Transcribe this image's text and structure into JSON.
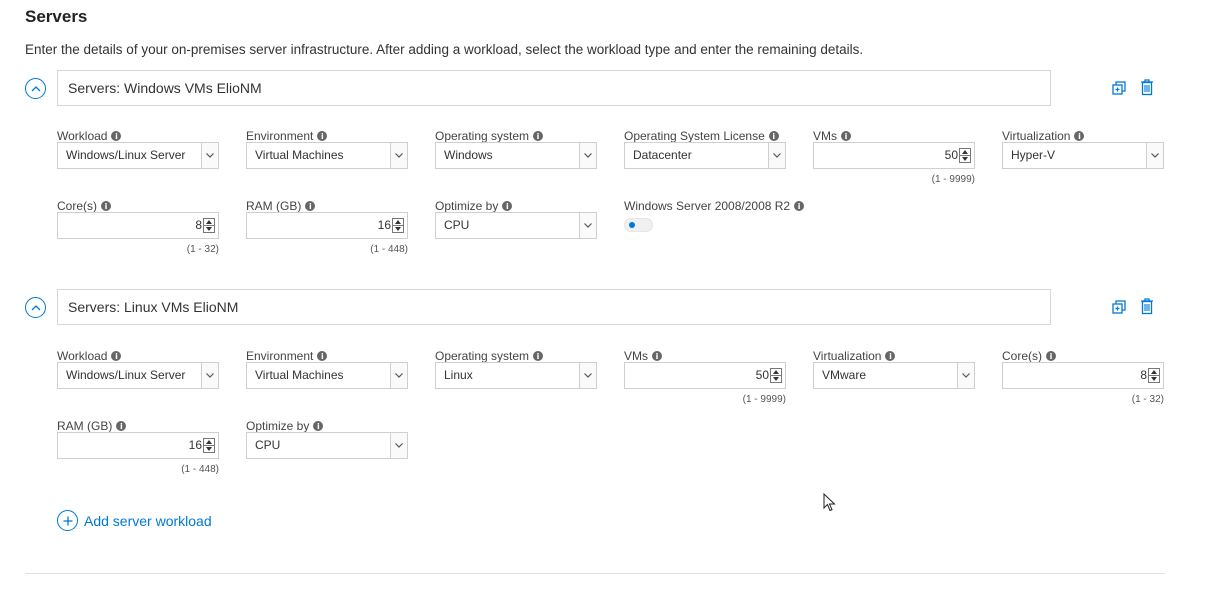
{
  "page": {
    "title": "Servers",
    "description": "Enter the details of your on-premises server infrastructure. After adding a workload, select the workload type and enter the remaining details."
  },
  "workload1": {
    "name": "Servers: Windows VMs ElioNM",
    "workload": {
      "label": "Workload",
      "value": "Windows/Linux Server"
    },
    "environment": {
      "label": "Environment",
      "value": "Virtual Machines"
    },
    "os": {
      "label": "Operating system",
      "value": "Windows"
    },
    "os_license": {
      "label": "Operating System License",
      "value": "Datacenter"
    },
    "vms": {
      "label": "VMs",
      "value": "50",
      "range": "(1 - 9999)"
    },
    "virtualization": {
      "label": "Virtualization",
      "value": "Hyper-V"
    },
    "cores": {
      "label": "Core(s)",
      "value": "8",
      "range": "(1 - 32)"
    },
    "ram": {
      "label": "RAM (GB)",
      "value": "16",
      "range": "(1 - 448)"
    },
    "optimize": {
      "label": "Optimize by",
      "value": "CPU"
    },
    "ws2008": {
      "label": "Windows Server 2008/2008 R2",
      "enabled": false
    }
  },
  "workload2": {
    "name": "Servers: Linux VMs ElioNM",
    "workload": {
      "label": "Workload",
      "value": "Windows/Linux Server"
    },
    "environment": {
      "label": "Environment",
      "value": "Virtual Machines"
    },
    "os": {
      "label": "Operating system",
      "value": "Linux"
    },
    "vms": {
      "label": "VMs",
      "value": "50",
      "range": "(1 - 9999)"
    },
    "virtualization": {
      "label": "Virtualization",
      "value": "VMware"
    },
    "cores": {
      "label": "Core(s)",
      "value": "8",
      "range": "(1 - 32)"
    },
    "ram": {
      "label": "RAM (GB)",
      "value": "16",
      "range": "(1 - 448)"
    },
    "optimize": {
      "label": "Optimize by",
      "value": "CPU"
    }
  },
  "add_workload": {
    "label": "Add server workload"
  },
  "icons": {
    "collapse": "chevron-up-icon",
    "clone": "clone-icon",
    "delete": "trash-icon",
    "info": "info-icon",
    "add": "plus-circle-icon"
  },
  "colors": {
    "accent": "#0078d4",
    "border": "#cfcfcf",
    "text": "#323130"
  }
}
